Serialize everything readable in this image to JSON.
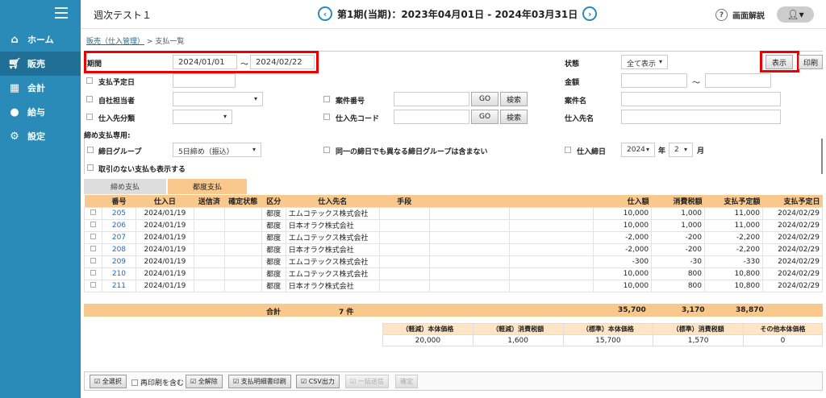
{
  "app": {
    "title": "週次テスト１"
  },
  "period": {
    "label": "第1期(当期)：2023年04月01日 - 2024年03月31日"
  },
  "header": {
    "help_label": "画面解説",
    "user_caret": "▾"
  },
  "sidebar": {
    "items": [
      {
        "label": "ホーム",
        "icon": "home-icon"
      },
      {
        "label": "販売",
        "icon": "cart-icon"
      },
      {
        "label": "会計",
        "icon": "calculator-icon"
      },
      {
        "label": "給与",
        "icon": "money-bag-icon"
      },
      {
        "label": "設定",
        "icon": "gear-icon"
      }
    ]
  },
  "breadcrumb": {
    "parent": "販売（仕入管理）",
    "sep": ">",
    "current": "支払一覧"
  },
  "filters": {
    "period_label": "期間",
    "period_from": "2024/01/01",
    "tilde": "～",
    "period_to": "2024/02/22",
    "status_label": "状態",
    "status_value": "全て表示",
    "show_button": "表示",
    "print_button": "印刷",
    "due_date_label": "支払予定日",
    "amount_label": "金額",
    "staff_label": "自社担当者",
    "case_no_label": "案件番号",
    "case_name_label": "案件名",
    "supplier_class_label": "仕入先分類",
    "supplier_code_label": "仕入先コード",
    "supplier_name_label": "仕入先名",
    "go_label": "GO",
    "search_label": "検索",
    "closing_section_label": "締め支払専用:",
    "closing_group_label": "締日グループ",
    "closing_group_value": "5日締め（振込）",
    "exclude_label": "同一の締日でも異なる締日グループは含まない",
    "purchase_close_label": "仕入締日",
    "year_value": "2024",
    "year_unit": "年",
    "month_value": "2",
    "month_unit": "月",
    "show_no_txn_label": "取引のない支払も表示する"
  },
  "tabs": [
    {
      "label": "締め支払"
    },
    {
      "label": "都度支払"
    }
  ],
  "table": {
    "headers": [
      "番号",
      "仕入日",
      "送信済",
      "確定状態",
      "区分",
      "仕入先名",
      "手段",
      "",
      "",
      "仕入額",
      "消費税額",
      "支払予定額",
      "支払予定日"
    ],
    "rows": [
      {
        "no": "205",
        "date": "2024/01/19",
        "type": "都度",
        "supplier": "エムコテックス株式会社",
        "amount": "10,000",
        "tax": "1,000",
        "pay": "11,000",
        "due": "2024/02/29"
      },
      {
        "no": "206",
        "date": "2024/01/19",
        "type": "都度",
        "supplier": "日本オラク株式会社",
        "amount": "10,000",
        "tax": "1,000",
        "pay": "11,000",
        "due": "2024/02/29"
      },
      {
        "no": "207",
        "date": "2024/01/19",
        "type": "都度",
        "supplier": "エムコテックス株式会社",
        "amount": "-2,000",
        "tax": "-200",
        "pay": "-2,200",
        "due": "2024/02/29"
      },
      {
        "no": "208",
        "date": "2024/01/19",
        "type": "都度",
        "supplier": "日本オラク株式会社",
        "amount": "-2,000",
        "tax": "-200",
        "pay": "-2,200",
        "due": "2024/02/29"
      },
      {
        "no": "209",
        "date": "2024/01/19",
        "type": "都度",
        "supplier": "エムコテックス株式会社",
        "amount": "-300",
        "tax": "-30",
        "pay": "-330",
        "due": "2024/02/29"
      },
      {
        "no": "210",
        "date": "2024/01/19",
        "type": "都度",
        "supplier": "エムコテックス株式会社",
        "amount": "10,000",
        "tax": "800",
        "pay": "10,800",
        "due": "2024/02/29"
      },
      {
        "no": "211",
        "date": "2024/01/19",
        "type": "都度",
        "supplier": "日本オラク株式会社",
        "amount": "10,000",
        "tax": "800",
        "pay": "10,800",
        "due": "2024/02/29"
      }
    ]
  },
  "totals": {
    "label": "合計",
    "count": "7 件",
    "amount": "35,700",
    "tax": "3,170",
    "pay": "38,870"
  },
  "summary": {
    "headers": [
      "（軽減）本体価格",
      "（軽減）消費税額",
      "（標準）本体価格",
      "（標準）消費税額",
      "その他本体価格"
    ],
    "values": [
      "20,000",
      "1,600",
      "15,700",
      "1,570",
      "0"
    ]
  },
  "footer": {
    "select_all": "全選択",
    "include_reprint": "再印刷を含む",
    "deselect_all": "全解除",
    "print_statement": "支払明細書印刷",
    "csv_export": "CSV出力",
    "bulk_send": "一括送信",
    "confirm": "確定"
  },
  "colors": {
    "sidebar": "#2a8bb8",
    "header_row": "#f9c88d",
    "highlight": "#ee0000"
  }
}
